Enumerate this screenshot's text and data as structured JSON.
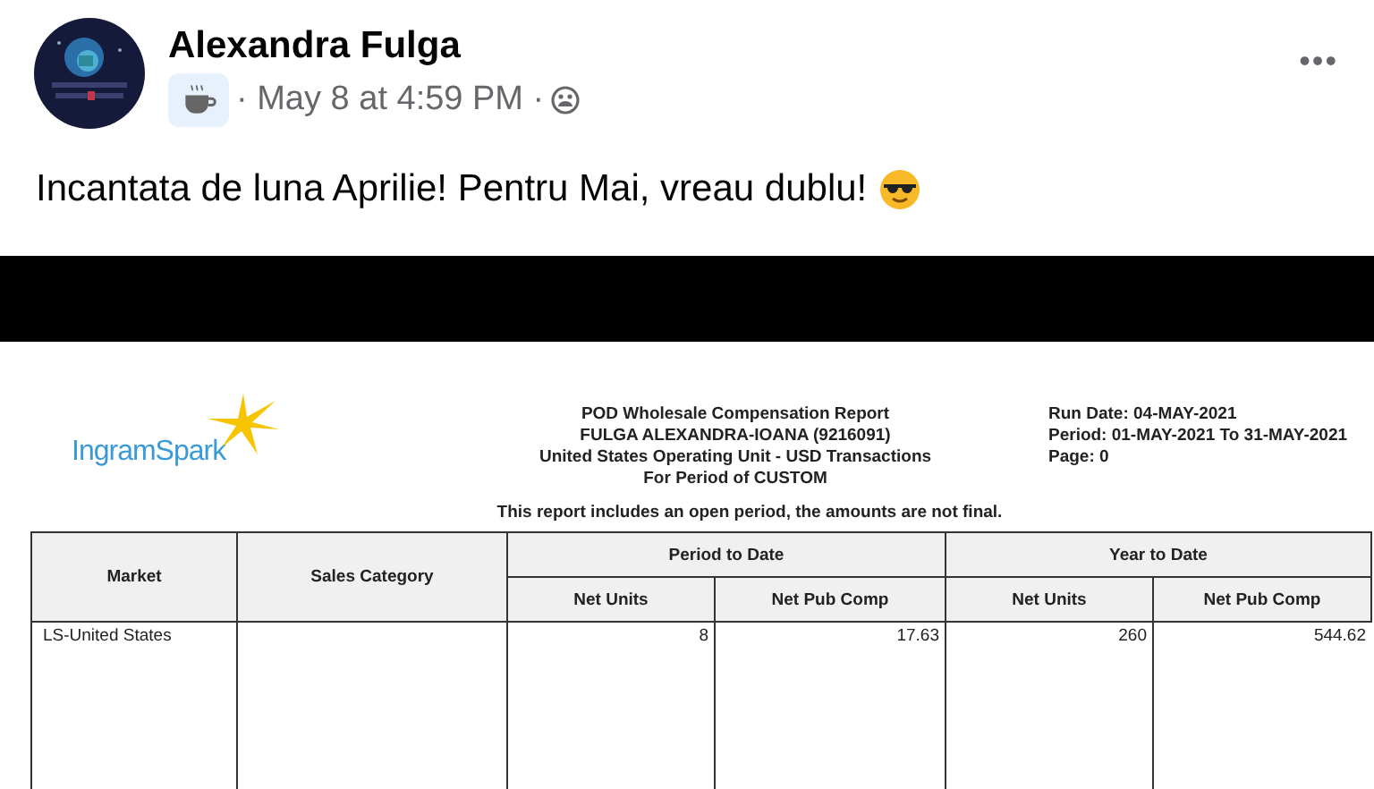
{
  "post": {
    "author": "Alexandra Fulga",
    "timestamp": "· May 8 at 4:59 PM ·",
    "text": "Incantata de luna Aprilie! Pentru Mai, vreau dublu!",
    "menu": "•••"
  },
  "report": {
    "logo": "IngramSpark",
    "title_lines": [
      "POD Wholesale Compensation Report",
      "FULGA ALEXANDRA-IOANA (9216091)",
      "United States Operating Unit - USD Transactions",
      "For Period of CUSTOM"
    ],
    "info_lines": [
      "Run Date: 04-MAY-2021",
      "Period: 01-MAY-2021 To 31-MAY-2021",
      "Page: 0"
    ],
    "notice": "This report includes an open period, the amounts are not final.",
    "table": {
      "columns": [
        "Market",
        "Sales Category"
      ],
      "groups": [
        {
          "label": "Period to Date",
          "columns": [
            "Net Units",
            "Net Pub Comp"
          ]
        },
        {
          "label": "Year to Date",
          "columns": [
            "Net Units",
            "Net Pub Comp"
          ]
        }
      ],
      "rows": [
        {
          "market": "LS-United States",
          "values": [
            "8",
            "17.63",
            "260",
            "544.62"
          ]
        }
      ]
    }
  }
}
